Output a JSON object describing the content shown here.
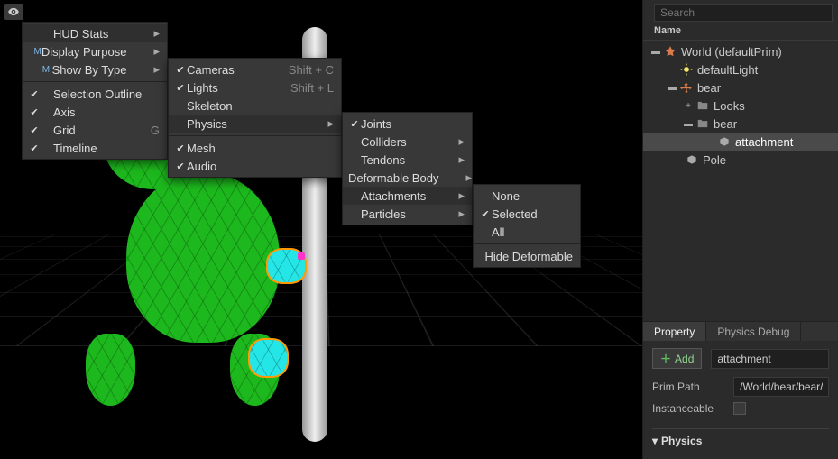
{
  "viewport_menu": {
    "items": [
      {
        "checked": false,
        "label": "HUD Stats",
        "arrow": true,
        "hover": true
      },
      {
        "checked": false,
        "label": "Display Purpose",
        "arrow": true,
        "prefix": "M"
      },
      {
        "checked": false,
        "label": "Show By Type",
        "arrow": true,
        "prefix": "M"
      },
      {
        "sep": true
      },
      {
        "checked": true,
        "label": "Selection Outline"
      },
      {
        "checked": true,
        "label": "Axis"
      },
      {
        "checked": true,
        "label": "Grid",
        "short": "G"
      },
      {
        "checked": true,
        "label": "Timeline"
      }
    ]
  },
  "show_by_type_menu": {
    "items": [
      {
        "checked": true,
        "label": "Cameras",
        "short": "Shift + C"
      },
      {
        "checked": true,
        "label": "Lights",
        "short": "Shift + L"
      },
      {
        "checked": false,
        "label": "Skeleton"
      },
      {
        "checked": false,
        "label": "Physics",
        "arrow": true,
        "hover": true
      },
      {
        "sep": true
      },
      {
        "checked": true,
        "label": "Mesh"
      },
      {
        "checked": true,
        "label": "Audio"
      }
    ]
  },
  "physics_menu": {
    "items": [
      {
        "checked": true,
        "label": "Joints"
      },
      {
        "label": "Colliders",
        "arrow": true
      },
      {
        "label": "Tendons",
        "arrow": true
      },
      {
        "label": "Deformable Body",
        "arrow": true
      },
      {
        "label": "Attachments",
        "arrow": true,
        "hover": true
      },
      {
        "label": "Particles",
        "arrow": true
      }
    ]
  },
  "attachments_menu": {
    "items": [
      {
        "label": "None"
      },
      {
        "checked": true,
        "label": "Selected"
      },
      {
        "label": "All"
      },
      {
        "sep": true
      },
      {
        "label": "Hide Deformable"
      }
    ]
  },
  "search": {
    "placeholder": "Search"
  },
  "tree": {
    "header": "Name",
    "world": {
      "label": "World (defaultPrim)"
    },
    "defaultLight": {
      "label": "defaultLight"
    },
    "bear_top": {
      "label": "bear"
    },
    "looks": {
      "label": "Looks"
    },
    "bear_inner": {
      "label": "bear"
    },
    "attachment": {
      "label": "attachment"
    },
    "pole": {
      "label": "Pole"
    }
  },
  "tabs": {
    "property": "Property",
    "physics_debug": "Physics Debug"
  },
  "property": {
    "add_label": "Add",
    "name_value": "attachment",
    "prim_path_label": "Prim Path",
    "prim_path_value": "/World/bear/bear/a",
    "instanceable_label": "Instanceable",
    "physics_section": "Physics"
  }
}
